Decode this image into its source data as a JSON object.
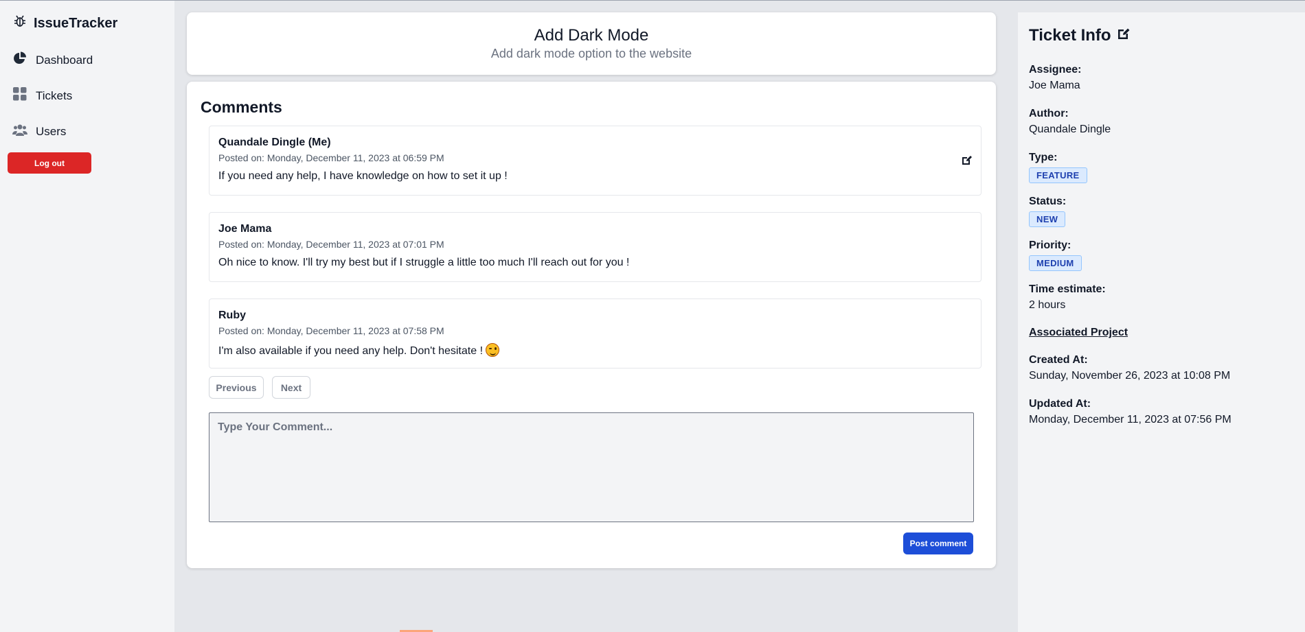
{
  "sidebar": {
    "brand": "IssueTracker",
    "items": [
      {
        "label": "Dashboard",
        "icon": "pie-chart-icon"
      },
      {
        "label": "Tickets",
        "icon": "grid-icon"
      },
      {
        "label": "Users",
        "icon": "users-icon"
      }
    ],
    "logout_label": "Log out"
  },
  "ticket": {
    "title": "Add Dark Mode",
    "description": "Add dark mode option to the website"
  },
  "comments": {
    "heading": "Comments",
    "items": [
      {
        "author": "Quandale Dingle (Me)",
        "posted": "Posted on: Monday, December 11, 2023 at 06:59 PM",
        "body": "If you need any help, I have knowledge on how to set it up !"
      },
      {
        "author": "Joe Mama",
        "posted": "Posted on: Monday, December 11, 2023 at 07:01 PM",
        "body": "Oh nice to know. I'll try my best but if I struggle a little too much I'll reach out for you !"
      },
      {
        "author": "Ruby",
        "posted": "Posted on: Monday, December 11, 2023 at 07:58 PM",
        "body": "I'm also available if you need any help. Don't hesitate !"
      }
    ],
    "previous_label": "Previous",
    "next_label": "Next",
    "input_placeholder": "Type Your Comment...",
    "post_label": "Post comment"
  },
  "info": {
    "title": "Ticket Info",
    "assignee_label": "Assignee:",
    "assignee": "Joe Mama",
    "author_label": "Author:",
    "author": "Quandale Dingle",
    "type_label": "Type:",
    "type": "FEATURE",
    "status_label": "Status:",
    "status": "NEW",
    "priority_label": "Priority:",
    "priority": "MEDIUM",
    "time_label": "Time estimate:",
    "time": "2 hours",
    "project_link": "Associated Project",
    "created_label": "Created At:",
    "created": "Sunday, November 26, 2023 at 10:08 PM",
    "updated_label": "Updated At:",
    "updated": "Monday, December 11, 2023 at 07:56 PM"
  },
  "colors": {
    "logout": "#dc2626",
    "post": "#1d4ed8",
    "badge_bg": "#dbeafe",
    "badge_text": "#1e40af"
  }
}
